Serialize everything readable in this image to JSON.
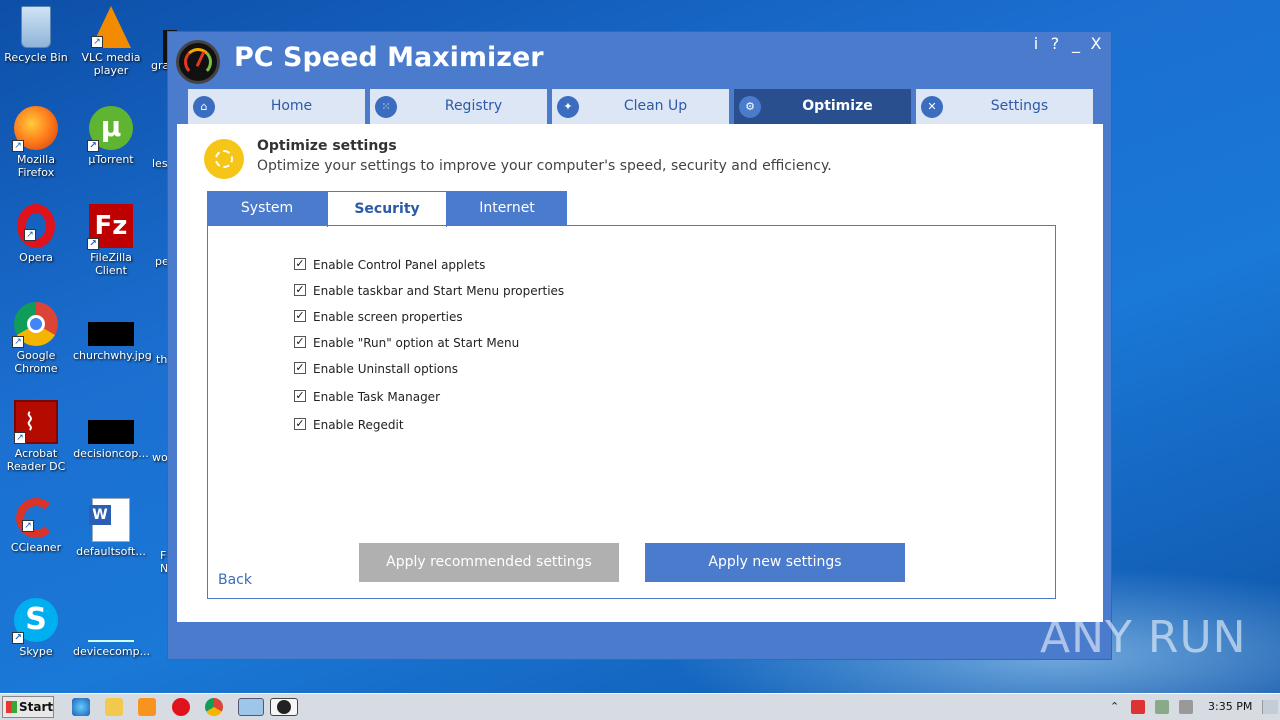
{
  "desktop": {
    "icons": [
      {
        "label": "Recycle Bin"
      },
      {
        "label": "VLC media player"
      },
      {
        "label": "Mozilla Firefox"
      },
      {
        "label": "µTorrent"
      },
      {
        "label": "Opera"
      },
      {
        "label": "FileZilla Client"
      },
      {
        "label": "Google Chrome"
      },
      {
        "label": "churchwhy.jpg"
      },
      {
        "label": "Acrobat Reader DC"
      },
      {
        "label": "decisioncop..."
      },
      {
        "label": "CCleaner"
      },
      {
        "label": "defaultsoft..."
      },
      {
        "label": "Skype"
      },
      {
        "label": "devicecomp..."
      }
    ],
    "peek_labels": [
      "gra",
      "lesl",
      "pe",
      "th",
      "wo",
      "F",
      "N"
    ]
  },
  "app": {
    "title": "PC Speed Maximizer",
    "controls": [
      "i",
      "?",
      "_",
      "X"
    ],
    "nav_tabs": [
      {
        "label": "Home",
        "icon": "home-icon"
      },
      {
        "label": "Registry",
        "icon": "registry-icon"
      },
      {
        "label": "Clean Up",
        "icon": "broom-icon"
      },
      {
        "label": "Optimize",
        "icon": "gear-icon",
        "active": true
      },
      {
        "label": "Settings",
        "icon": "tools-icon"
      }
    ],
    "header": {
      "title": "Optimize settings",
      "description": "Optimize your settings to improve your computer's speed, security and efficiency."
    },
    "sub_tabs": [
      {
        "label": "System"
      },
      {
        "label": "Security",
        "active": true
      },
      {
        "label": "Internet"
      }
    ],
    "options": [
      {
        "label": "Enable Control Panel applets",
        "checked": true
      },
      {
        "label": "Enable taskbar and Start Menu properties",
        "checked": true
      },
      {
        "label": "Enable screen properties",
        "checked": true
      },
      {
        "label": "Enable \"Run\" option at Start Menu",
        "checked": true
      },
      {
        "label": "Enable Uninstall options",
        "checked": true
      },
      {
        "label": "Enable Task Manager",
        "checked": true
      },
      {
        "label": "Enable Regedit",
        "checked": true
      }
    ],
    "buttons": {
      "recommended": "Apply recommended settings",
      "apply_new": "Apply new settings",
      "back": "Back"
    }
  },
  "watermark": "ANY RUN",
  "taskbar": {
    "start_label": "Start",
    "clock": "3:35 PM"
  },
  "colors": {
    "accent": "#4a7bcc",
    "nav_active": "#2a4f8f",
    "nav_inactive": "#dde6f4",
    "button_gray": "#b0b0b0",
    "optimize_icon": "#f5c518"
  }
}
